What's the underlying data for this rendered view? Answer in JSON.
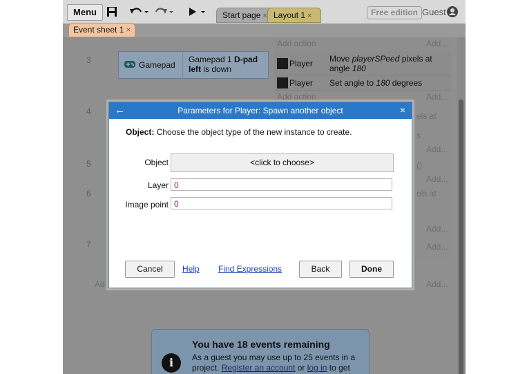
{
  "toolbar": {
    "menu_label": "Menu",
    "tabs": [
      {
        "label": "Start page",
        "close": "×"
      },
      {
        "label": "Layout 1",
        "close": "×"
      }
    ],
    "free_edition": "Free edition",
    "guest": "Guest"
  },
  "sheet_tab": {
    "label": "Event sheet 1",
    "close": "×"
  },
  "sheet": {
    "row_numbers": [
      "3",
      "4",
      "5",
      "6",
      "7"
    ],
    "add_action": "Add action",
    "add_short": "Add...",
    "add_left": "Ad",
    "condition": {
      "object": "Gamepad",
      "text_prefix": "Gamepad 1 ",
      "text_bold": "D-pad left",
      "text_suffix": " is down"
    },
    "actions": [
      {
        "object": "Player",
        "text_prefix": "Move ",
        "text_em1": "playerSPeed",
        "text_mid": " pixels at angle ",
        "text_em2": "180"
      },
      {
        "object": "Player",
        "text_prefix": "Set angle to ",
        "text_em": "180",
        "text_suffix": " degrees"
      }
    ],
    "partial": [
      "els at",
      "s",
      "()",
      "els at"
    ]
  },
  "notice": {
    "icon": "i",
    "title": "You have 18 events remaining",
    "body_prefix": "As a guest you may use up to 25 events in a project. ",
    "register_link": "Register an account",
    "or": " or ",
    "login_link": "log in",
    "body_suffix": " to get"
  },
  "dialog": {
    "back": "←",
    "title": "Parameters for Player: Spawn another object",
    "close": "×",
    "desc_bold": "Object:",
    "desc_rest": " Choose the object type of the new instance to create.",
    "object_label": "Object",
    "object_value": "<click to choose>",
    "layer_label": "Layer",
    "layer_value": "0",
    "image_point_label": "Image point",
    "image_point_value": "0",
    "cancel": "Cancel",
    "help": "Help",
    "find_expressions": "Find Expressions",
    "back_btn": "Back",
    "done": "Done"
  },
  "colors": {
    "title_bar": "#2a78c9",
    "param_value": "#8a1d8c",
    "link": "#1f44b5"
  }
}
